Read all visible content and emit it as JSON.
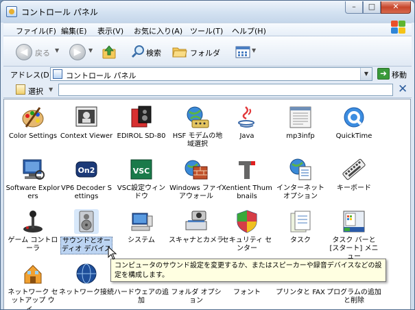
{
  "window": {
    "title": "コントロール パネル",
    "controls": {
      "minimize": "–",
      "maximize": "□",
      "close": "✕"
    }
  },
  "menu": {
    "items": [
      {
        "label": "ファイル(F)"
      },
      {
        "label": "編集(E)"
      },
      {
        "label": "表示(V)"
      },
      {
        "label": "お気に入り(A)"
      },
      {
        "label": "ツール(T)"
      },
      {
        "label": "ヘルプ(H)"
      }
    ]
  },
  "toolbar": {
    "back_label": "戻る",
    "search_label": "検索",
    "folder_label": "フォルダ"
  },
  "address": {
    "label": "アドレス(D)",
    "value": "コントロール パネル",
    "go_label": "移動"
  },
  "selectbar": {
    "select_label": "選択",
    "search_value": ""
  },
  "items": [
    {
      "label": "Color Settings",
      "icon": "color-settings-icon"
    },
    {
      "label": "Context Viewer",
      "icon": "context-viewer-icon"
    },
    {
      "label": "EDIROL SD-80",
      "icon": "edirol-icon"
    },
    {
      "label": "HSF モデムの地域選択",
      "icon": "modem-icon"
    },
    {
      "label": "Java",
      "icon": "java-icon"
    },
    {
      "label": "mp3infp",
      "icon": "mp3infp-icon"
    },
    {
      "label": "QuickTime",
      "icon": "quicktime-icon"
    },
    {
      "label": "Software Explorers",
      "icon": "software-explorers-icon"
    },
    {
      "label": "VP6 Decoder Settings",
      "icon": "vp6-icon"
    },
    {
      "label": "VSC設定ウィンドウ",
      "icon": "vsc-icon"
    },
    {
      "label": "Windows ファイアウォール",
      "icon": "firewall-icon"
    },
    {
      "label": "Xentient Thumbnails",
      "icon": "xentient-icon"
    },
    {
      "label": "インターネット オプション",
      "icon": "internet-options-icon"
    },
    {
      "label": "キーボード",
      "icon": "keyboard-icon"
    },
    {
      "label": "ゲーム コントローラ",
      "icon": "game-controller-icon"
    },
    {
      "label": "サウンドとオーディオ デバイス",
      "icon": "sound-icon"
    },
    {
      "label": "システム",
      "icon": "system-icon"
    },
    {
      "label": "スキャナとカメラ",
      "icon": "scanner-camera-icon"
    },
    {
      "label": "セキュリティ センター",
      "icon": "security-center-icon"
    },
    {
      "label": "タスク",
      "icon": "tasks-icon"
    },
    {
      "label": "タスク バーと [スタート] メニュー",
      "icon": "taskbar-icon"
    },
    {
      "label": "ネットワーク セットアップ ウィ...",
      "icon": "network-setup-icon"
    },
    {
      "label": "ネットワーク接続",
      "icon": "network-connections-icon"
    },
    {
      "label": "ハードウェアの追加",
      "icon": "add-hardware-icon"
    },
    {
      "label": "フォルダ オプション",
      "icon": "folder-options-icon"
    },
    {
      "label": "フォント",
      "icon": "fonts-icon"
    },
    {
      "label": "プリンタと FAX",
      "icon": "printers-icon"
    },
    {
      "label": "プログラムの追加と削除",
      "icon": "add-remove-programs-icon"
    }
  ],
  "tooltip": {
    "text": "コンピュータのサウンド設定を変更するか、またはスピーカーや録音デバイスなどの設定を構成します。"
  }
}
